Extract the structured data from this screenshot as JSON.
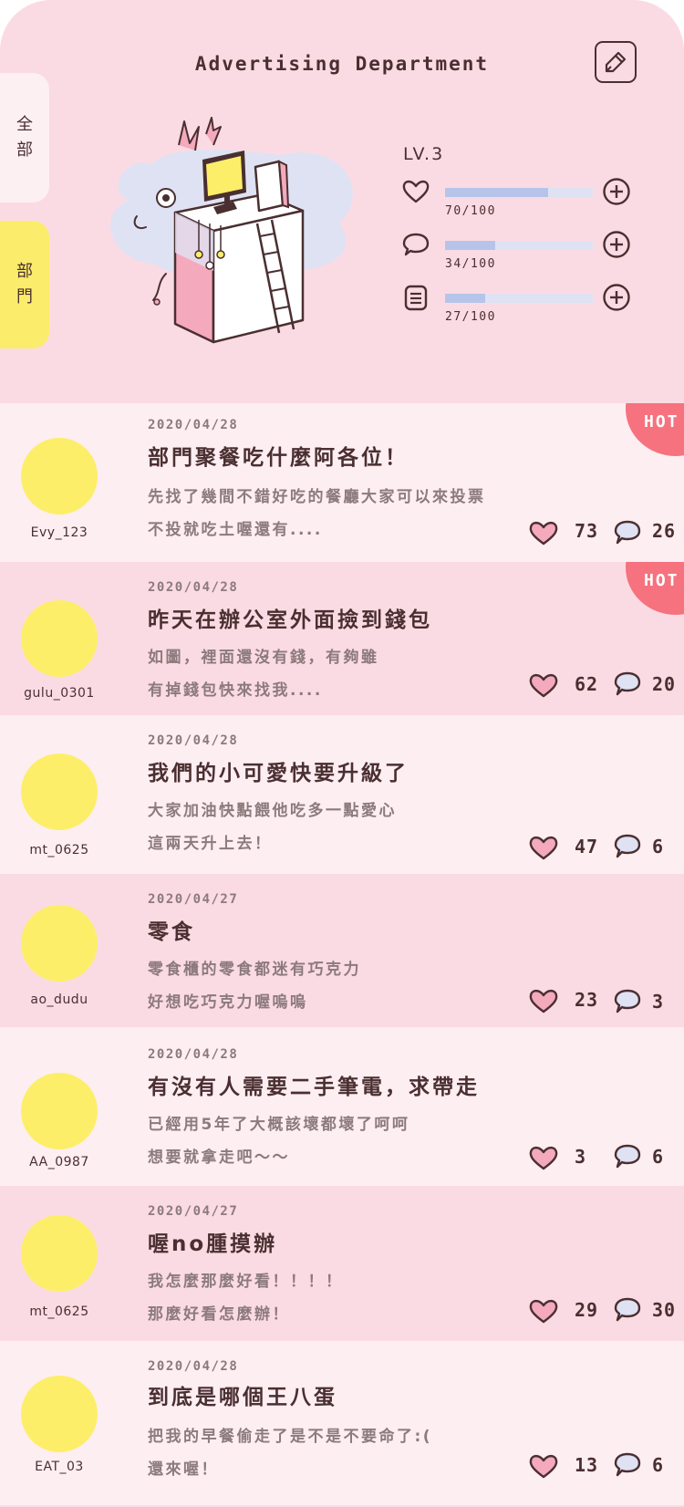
{
  "header": {
    "title": "Advertising Department",
    "edit_icon": "pencil-icon"
  },
  "side_tabs": {
    "all": [
      "全",
      "部"
    ],
    "dept": [
      "部",
      "門"
    ]
  },
  "stats": {
    "level": "LV.3",
    "rows": [
      {
        "icon": "heart-icon",
        "count": "70/100",
        "progress": 0.7
      },
      {
        "icon": "speech-bubble-icon",
        "count": "34/100",
        "progress": 0.34
      },
      {
        "icon": "document-icon",
        "count": "27/100",
        "progress": 0.27
      }
    ]
  },
  "posts": [
    {
      "user": "Evy_123",
      "date": "2020/04/28",
      "title": "部門聚餐吃什麼阿各位！",
      "line1": "先找了幾間不錯好吃的餐廳大家可以來投票",
      "line2": "不投就吃土喔還有....",
      "likes": "73",
      "comments": "26",
      "hot": "HOT"
    },
    {
      "user": "gulu_0301",
      "date": "2020/04/28",
      "title": "昨天在辦公室外面撿到錢包",
      "line1": "如圖，裡面還沒有錢，有夠雖",
      "line2": "有掉錢包快來找我....",
      "likes": "62",
      "comments": "20",
      "hot": "HOT"
    },
    {
      "user": "mt_0625",
      "date": "2020/04/28",
      "title": "我們的小可愛快要升級了",
      "line1": "大家加油快點餵他吃多一點愛心",
      "line2": "這兩天升上去！",
      "likes": "47",
      "comments": "6"
    },
    {
      "user": "ao_dudu",
      "date": "2020/04/27",
      "title": "零食",
      "line1": "零食櫃的零食都迷有巧克力",
      "line2": "好想吃巧克力喔嗚嗚",
      "likes": "23",
      "comments": "3"
    },
    {
      "user": "AA_0987",
      "date": "2020/04/28",
      "title": "有沒有人需要二手筆電，求帶走",
      "line1": "已經用5年了大概該壞都壞了呵呵",
      "line2": "想要就拿走吧～～",
      "likes": "3",
      "comments": "6"
    },
    {
      "user": "mt_0625",
      "date": "2020/04/27",
      "title": "喔no腫摸辦",
      "line1": "我怎麼那麼好看！！！！",
      "line2": "那麼好看怎麼辦！",
      "likes": "29",
      "comments": "30"
    },
    {
      "user": "EAT_03",
      "date": "2020/04/28",
      "title": "到底是哪個王八蛋",
      "line1": "把我的早餐偷走了是不是不要命了:(",
      "line2": "還來喔！",
      "likes": "13",
      "comments": "6"
    }
  ],
  "colors": {
    "background": "#fbdbe3",
    "card_light": "#fdeef2",
    "accent_yellow": "#fdee6a",
    "hot_badge": "#f6727f",
    "bar_fill": "#b6c4ea",
    "text_dark": "#4a2f31",
    "text_muted": "#8c7a7c"
  }
}
